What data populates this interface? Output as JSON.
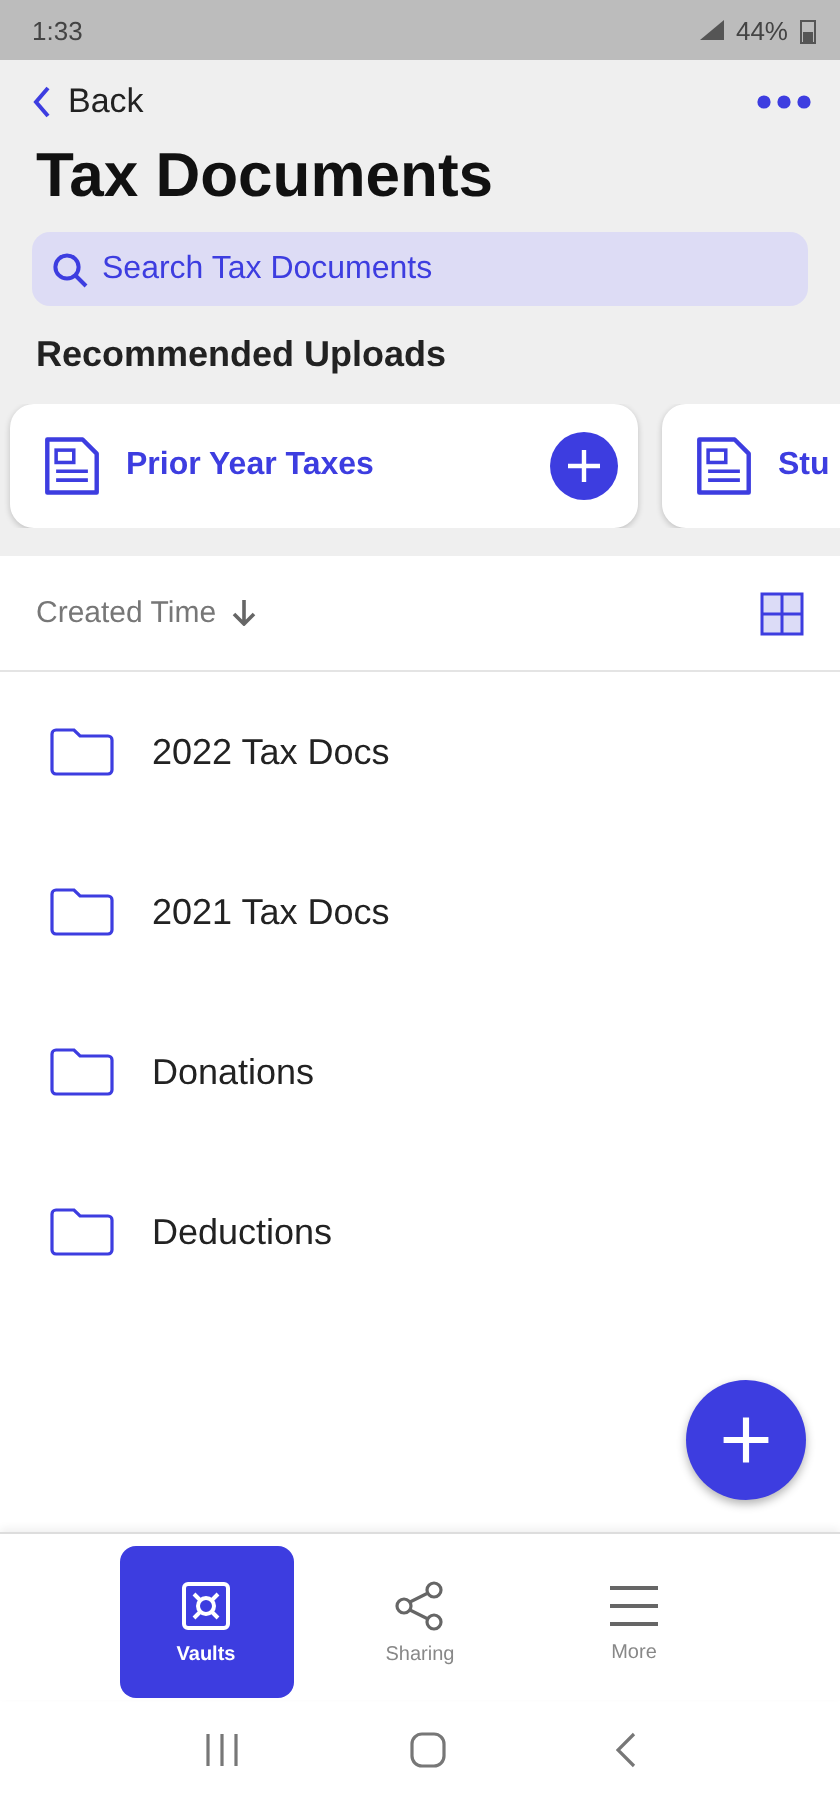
{
  "status_bar": {
    "time": "1:33",
    "battery": "44%"
  },
  "header": {
    "back": "Back",
    "title": "Tax Documents"
  },
  "search": {
    "placeholder": "Search Tax Documents"
  },
  "recommended": {
    "heading": "Recommended Uploads",
    "cards": [
      {
        "label": "Prior Year Taxes"
      },
      {
        "label": "Stu"
      }
    ]
  },
  "sort": {
    "label": "Created Time"
  },
  "folders": [
    {
      "name": "2022 Tax Docs"
    },
    {
      "name": "2021 Tax Docs"
    },
    {
      "name": "Donations"
    },
    {
      "name": "Deductions"
    }
  ],
  "bottom_nav": [
    {
      "kind": "vault",
      "label": "Vaults",
      "selected": true
    },
    {
      "kind": "share",
      "label": "Sharing",
      "selected": false
    },
    {
      "kind": "menu",
      "label": "More",
      "selected": false
    }
  ]
}
